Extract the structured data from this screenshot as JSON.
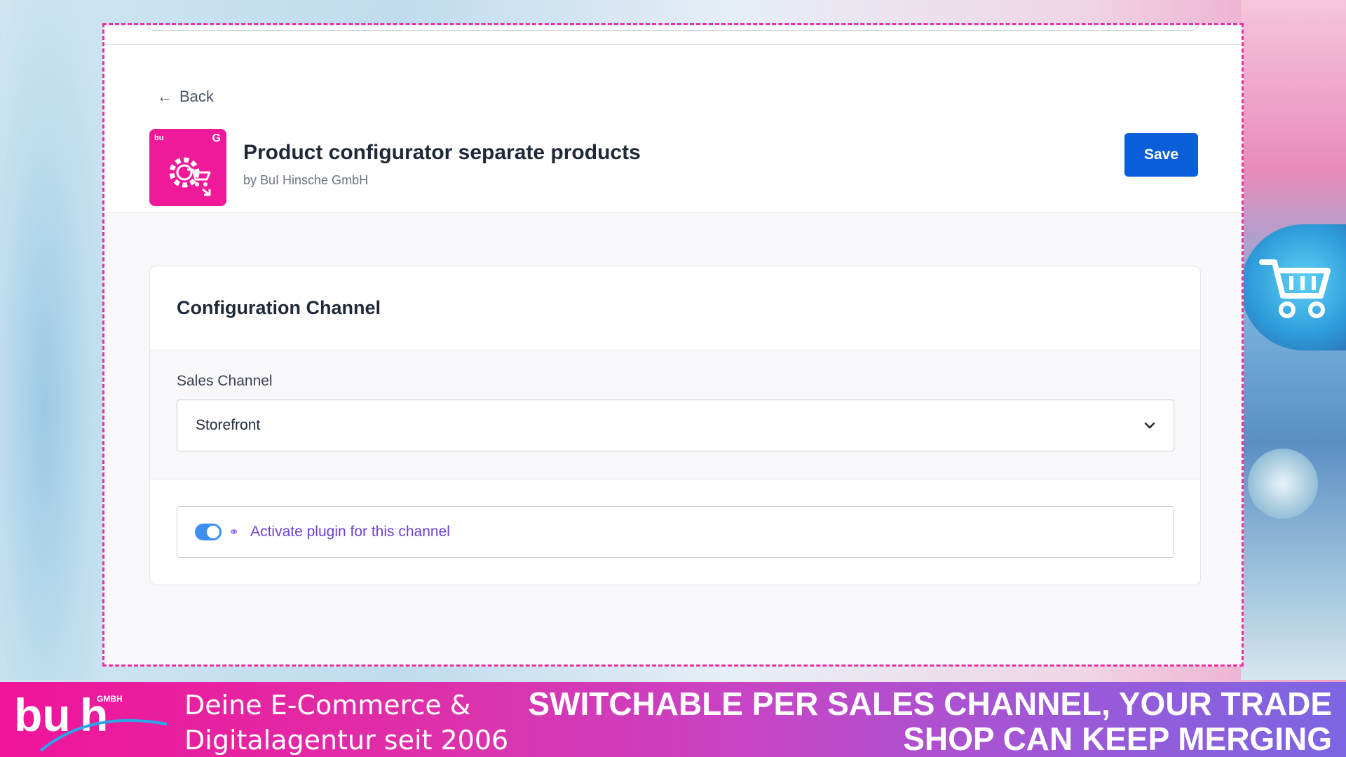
{
  "header": {
    "back_label": "Back",
    "plugin_title": "Product configurator separate products",
    "plugin_vendor": "by BuI Hinsche GmbH",
    "save_label": "Save",
    "logo_text": "bu"
  },
  "config_card": {
    "title": "Configuration Channel",
    "sales_channel_label": "Sales Channel",
    "sales_channel_value": "Storefront",
    "activate_label": "Activate plugin for this channel",
    "activate_enabled": true
  },
  "banner": {
    "logo_text": "bu",
    "logo_suffix": "GMBH",
    "tagline_line1": "Deine E-Commerce &",
    "tagline_line2": "Digitalagentur seit 2006",
    "headline_line1": "SWITCHABLE PER SALES CHANNEL, YOUR TRADE",
    "headline_line2": "SHOP CAN KEEP MERGING"
  },
  "colors": {
    "accent_pink": "#f0199a",
    "save_blue": "#0a5ed8",
    "toggle_blue": "#3d8ff1",
    "link_purple": "#6d3fd6"
  }
}
